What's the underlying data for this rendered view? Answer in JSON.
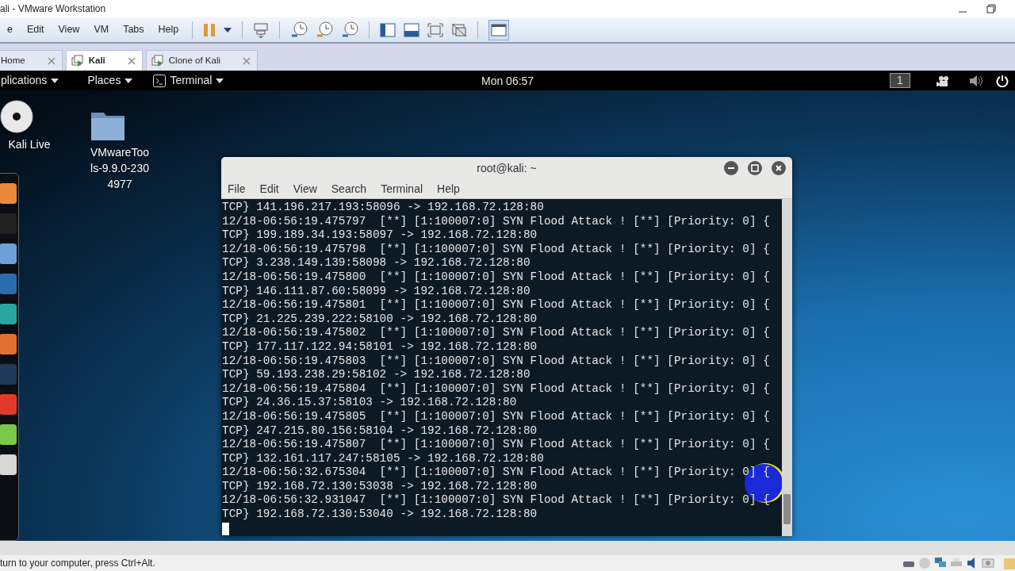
{
  "window": {
    "title": "ali - VMware Workstation"
  },
  "menu": [
    "e",
    "Edit",
    "View",
    "VM",
    "Tabs",
    "Help"
  ],
  "tabs": [
    {
      "label": "Home",
      "selected": false
    },
    {
      "label": "Kali",
      "selected": true
    },
    {
      "label": "Clone of Kali",
      "selected": false
    }
  ],
  "top_panel": {
    "menus": [
      "plications",
      "Places",
      "Terminal"
    ],
    "clock": "Mon 06:57",
    "workspace": "1"
  },
  "desktop_icons": [
    {
      "label": "Kali Live",
      "kind": "disc"
    },
    {
      "label": "VMwareTools-9.9.0-2304977",
      "kind": "folder"
    }
  ],
  "terminal": {
    "title": "root@kali: ~",
    "menu": [
      "File",
      "Edit",
      "View",
      "Search",
      "Terminal",
      "Help"
    ],
    "lines": [
      "TCP} 141.196.217.193:58096 -> 192.168.72.128:80",
      "12/18-06:56:19.475797  [**] [1:100007:0] SYN Flood Attack ! [**] [Priority: 0] {",
      "TCP} 199.189.34.193:58097 -> 192.168.72.128:80",
      "12/18-06:56:19.475798  [**] [1:100007:0] SYN Flood Attack ! [**] [Priority: 0] {",
      "TCP} 3.238.149.139:58098 -> 192.168.72.128:80",
      "12/18-06:56:19.475800  [**] [1:100007:0] SYN Flood Attack ! [**] [Priority: 0] {",
      "TCP} 146.111.87.60:58099 -> 192.168.72.128:80",
      "12/18-06:56:19.475801  [**] [1:100007:0] SYN Flood Attack ! [**] [Priority: 0] {",
      "TCP} 21.225.239.222:58100 -> 192.168.72.128:80",
      "12/18-06:56:19.475802  [**] [1:100007:0] SYN Flood Attack ! [**] [Priority: 0] {",
      "TCP} 177.117.122.94:58101 -> 192.168.72.128:80",
      "12/18-06:56:19.475803  [**] [1:100007:0] SYN Flood Attack ! [**] [Priority: 0] {",
      "TCP} 59.193.238.29:58102 -> 192.168.72.128:80",
      "12/18-06:56:19.475804  [**] [1:100007:0] SYN Flood Attack ! [**] [Priority: 0] {",
      "TCP} 24.36.15.37:58103 -> 192.168.72.128:80",
      "12/18-06:56:19.475805  [**] [1:100007:0] SYN Flood Attack ! [**] [Priority: 0] {",
      "TCP} 247.215.80.156:58104 -> 192.168.72.128:80",
      "12/18-06:56:19.475807  [**] [1:100007:0] SYN Flood Attack ! [**] [Priority: 0] {",
      "TCP} 132.161.117.247:58105 -> 192.168.72.128:80",
      "12/18-06:56:32.675304  [**] [1:100007:0] SYN Flood Attack ! [**] [Priority: 0] {",
      "TCP} 192.168.72.130:53038 -> 192.168.72.128:80",
      "12/18-06:56:32.931047  [**] [1:100007:0] SYN Flood Attack ! [**] [Priority: 0] {",
      "TCP} 192.168.72.130:53040 -> 192.168.72.128:80"
    ]
  },
  "status_bar": {
    "text": "turn to your computer, press Ctrl+Alt."
  }
}
